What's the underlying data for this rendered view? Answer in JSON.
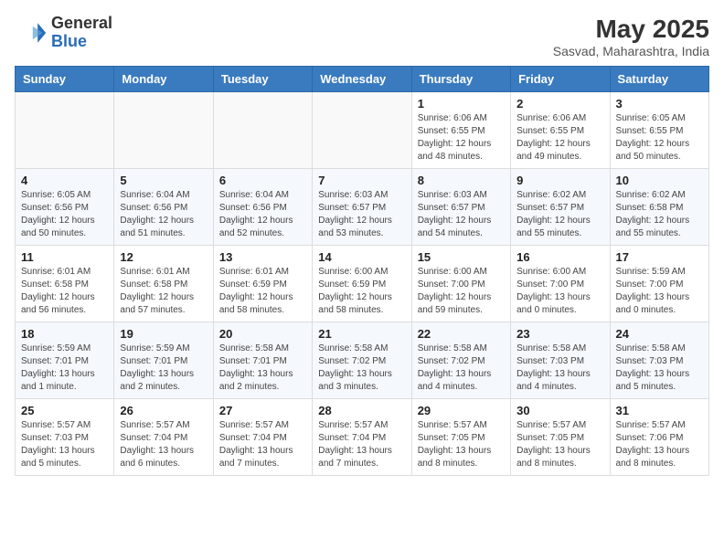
{
  "header": {
    "logo_line1": "General",
    "logo_line2": "Blue",
    "month_year": "May 2025",
    "location": "Sasvad, Maharashtra, India"
  },
  "weekdays": [
    "Sunday",
    "Monday",
    "Tuesday",
    "Wednesday",
    "Thursday",
    "Friday",
    "Saturday"
  ],
  "weeks": [
    [
      {
        "day": "",
        "info": ""
      },
      {
        "day": "",
        "info": ""
      },
      {
        "day": "",
        "info": ""
      },
      {
        "day": "",
        "info": ""
      },
      {
        "day": "1",
        "info": "Sunrise: 6:06 AM\nSunset: 6:55 PM\nDaylight: 12 hours\nand 48 minutes."
      },
      {
        "day": "2",
        "info": "Sunrise: 6:06 AM\nSunset: 6:55 PM\nDaylight: 12 hours\nand 49 minutes."
      },
      {
        "day": "3",
        "info": "Sunrise: 6:05 AM\nSunset: 6:55 PM\nDaylight: 12 hours\nand 50 minutes."
      }
    ],
    [
      {
        "day": "4",
        "info": "Sunrise: 6:05 AM\nSunset: 6:56 PM\nDaylight: 12 hours\nand 50 minutes."
      },
      {
        "day": "5",
        "info": "Sunrise: 6:04 AM\nSunset: 6:56 PM\nDaylight: 12 hours\nand 51 minutes."
      },
      {
        "day": "6",
        "info": "Sunrise: 6:04 AM\nSunset: 6:56 PM\nDaylight: 12 hours\nand 52 minutes."
      },
      {
        "day": "7",
        "info": "Sunrise: 6:03 AM\nSunset: 6:57 PM\nDaylight: 12 hours\nand 53 minutes."
      },
      {
        "day": "8",
        "info": "Sunrise: 6:03 AM\nSunset: 6:57 PM\nDaylight: 12 hours\nand 54 minutes."
      },
      {
        "day": "9",
        "info": "Sunrise: 6:02 AM\nSunset: 6:57 PM\nDaylight: 12 hours\nand 55 minutes."
      },
      {
        "day": "10",
        "info": "Sunrise: 6:02 AM\nSunset: 6:58 PM\nDaylight: 12 hours\nand 55 minutes."
      }
    ],
    [
      {
        "day": "11",
        "info": "Sunrise: 6:01 AM\nSunset: 6:58 PM\nDaylight: 12 hours\nand 56 minutes."
      },
      {
        "day": "12",
        "info": "Sunrise: 6:01 AM\nSunset: 6:58 PM\nDaylight: 12 hours\nand 57 minutes."
      },
      {
        "day": "13",
        "info": "Sunrise: 6:01 AM\nSunset: 6:59 PM\nDaylight: 12 hours\nand 58 minutes."
      },
      {
        "day": "14",
        "info": "Sunrise: 6:00 AM\nSunset: 6:59 PM\nDaylight: 12 hours\nand 58 minutes."
      },
      {
        "day": "15",
        "info": "Sunrise: 6:00 AM\nSunset: 7:00 PM\nDaylight: 12 hours\nand 59 minutes."
      },
      {
        "day": "16",
        "info": "Sunrise: 6:00 AM\nSunset: 7:00 PM\nDaylight: 13 hours\nand 0 minutes."
      },
      {
        "day": "17",
        "info": "Sunrise: 5:59 AM\nSunset: 7:00 PM\nDaylight: 13 hours\nand 0 minutes."
      }
    ],
    [
      {
        "day": "18",
        "info": "Sunrise: 5:59 AM\nSunset: 7:01 PM\nDaylight: 13 hours\nand 1 minute."
      },
      {
        "day": "19",
        "info": "Sunrise: 5:59 AM\nSunset: 7:01 PM\nDaylight: 13 hours\nand 2 minutes."
      },
      {
        "day": "20",
        "info": "Sunrise: 5:58 AM\nSunset: 7:01 PM\nDaylight: 13 hours\nand 2 minutes."
      },
      {
        "day": "21",
        "info": "Sunrise: 5:58 AM\nSunset: 7:02 PM\nDaylight: 13 hours\nand 3 minutes."
      },
      {
        "day": "22",
        "info": "Sunrise: 5:58 AM\nSunset: 7:02 PM\nDaylight: 13 hours\nand 4 minutes."
      },
      {
        "day": "23",
        "info": "Sunrise: 5:58 AM\nSunset: 7:03 PM\nDaylight: 13 hours\nand 4 minutes."
      },
      {
        "day": "24",
        "info": "Sunrise: 5:58 AM\nSunset: 7:03 PM\nDaylight: 13 hours\nand 5 minutes."
      }
    ],
    [
      {
        "day": "25",
        "info": "Sunrise: 5:57 AM\nSunset: 7:03 PM\nDaylight: 13 hours\nand 5 minutes."
      },
      {
        "day": "26",
        "info": "Sunrise: 5:57 AM\nSunset: 7:04 PM\nDaylight: 13 hours\nand 6 minutes."
      },
      {
        "day": "27",
        "info": "Sunrise: 5:57 AM\nSunset: 7:04 PM\nDaylight: 13 hours\nand 7 minutes."
      },
      {
        "day": "28",
        "info": "Sunrise: 5:57 AM\nSunset: 7:04 PM\nDaylight: 13 hours\nand 7 minutes."
      },
      {
        "day": "29",
        "info": "Sunrise: 5:57 AM\nSunset: 7:05 PM\nDaylight: 13 hours\nand 8 minutes."
      },
      {
        "day": "30",
        "info": "Sunrise: 5:57 AM\nSunset: 7:05 PM\nDaylight: 13 hours\nand 8 minutes."
      },
      {
        "day": "31",
        "info": "Sunrise: 5:57 AM\nSunset: 7:06 PM\nDaylight: 13 hours\nand 8 minutes."
      }
    ]
  ]
}
